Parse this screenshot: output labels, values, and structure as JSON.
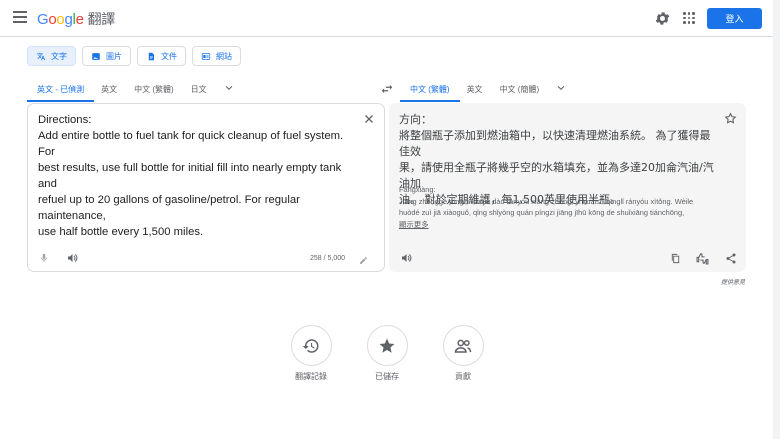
{
  "header": {
    "logo_google": [
      "G",
      "o",
      "o",
      "g",
      "l",
      "e"
    ],
    "product": "翻譯",
    "signin_label": "登入"
  },
  "modes": [
    {
      "label": "文字",
      "icon": "translate-icon"
    },
    {
      "label": "圖片",
      "icon": "image-icon"
    },
    {
      "label": "文件",
      "icon": "document-icon"
    },
    {
      "label": "網站",
      "icon": "website-icon"
    }
  ],
  "source_langs": [
    "英文 - 已偵測",
    "英文",
    "中文 (繁體)",
    "日文"
  ],
  "target_langs": [
    "中文 (繁體)",
    "英文",
    "中文 (簡體)"
  ],
  "source": {
    "lines": [
      "Directions:",
      "Add entire bottle to fuel tank for quick cleanup of fuel system. For",
      "best results, use full bottle for initial fill into nearly empty tank and",
      "refuel up to 20 gallons of gasoline/petrol. For regular maintenance,",
      "use half bottle every 1,500 miles."
    ],
    "char_count": "258 / 5,000"
  },
  "target": {
    "lines": [
      "方向：",
      "將整個瓶子添加到燃油箱中，以快速清理燃油系統。 為了獲得最佳效",
      "果，請使用全瓶子將幾乎空的水箱填充，並為多達20加侖汽油/汽油加",
      "油。 對於定期維護，每1,500英里使用半瓶。"
    ],
    "romanization": [
      "Fāngxiàng:",
      "Jiāng zhěnggè píngzi tiānjiā dào rányóu xiāng zhōng, yǐ kuàisù qīnglǐ rányóu xìtǒng. Wèile",
      "huòdé zuì jiā xiàoguǒ, qǐng shǐyòng quán píngzi jiāng jīhū kōng de shuǐxiāng tiánchōng,"
    ],
    "show_more": "顯示更多"
  },
  "feedback": "提供意見",
  "bottom_actions": [
    {
      "label": "翻譯記錄",
      "icon": "history-icon"
    },
    {
      "label": "已儲存",
      "icon": "star-icon"
    },
    {
      "label": "貢獻",
      "icon": "contribute-icon"
    }
  ],
  "colors": {
    "accent": "#1a73e8",
    "panel": "#f5f5f5"
  }
}
